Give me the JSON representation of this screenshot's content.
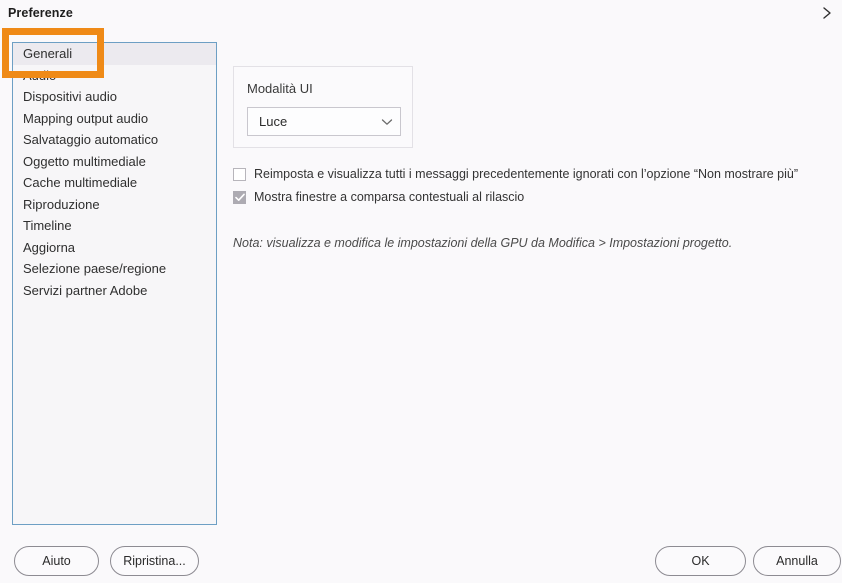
{
  "window": {
    "title": "Preferenze",
    "expand_icon": "chevron-right-icon"
  },
  "sidebar": {
    "items": [
      {
        "label": "Generali",
        "selected": true
      },
      {
        "label": "Audio",
        "selected": false
      },
      {
        "label": "Dispositivi audio",
        "selected": false
      },
      {
        "label": "Mapping output audio",
        "selected": false
      },
      {
        "label": "Salvataggio automatico",
        "selected": false
      },
      {
        "label": "Oggetto multimediale",
        "selected": false
      },
      {
        "label": "Cache multimediale",
        "selected": false
      },
      {
        "label": "Riproduzione",
        "selected": false
      },
      {
        "label": "Timeline",
        "selected": false
      },
      {
        "label": "Aggiorna",
        "selected": false
      },
      {
        "label": "Selezione paese/regione",
        "selected": false
      },
      {
        "label": "Servizi partner Adobe",
        "selected": false
      }
    ]
  },
  "main": {
    "ui_mode": {
      "label": "Modalità UI",
      "selected_value": "Luce",
      "chevron_icon": "chevron-down-icon"
    },
    "checkboxes": [
      {
        "label": "Reimposta e visualizza tutti i messaggi precedentemente ignorati con l’opzione “Non mostrare più”",
        "checked": false
      },
      {
        "label": "Mostra finestre a comparsa contestuali al rilascio",
        "checked": true
      }
    ],
    "note": "Nota: visualizza e modifica le impostazioni della GPU da Modifica > Impostazioni progetto."
  },
  "footer": {
    "help_label": "Aiuto",
    "reset_label": "Ripristina...",
    "ok_label": "OK",
    "cancel_label": "Annulla"
  },
  "annotation": {
    "color": "#ef8a17"
  }
}
